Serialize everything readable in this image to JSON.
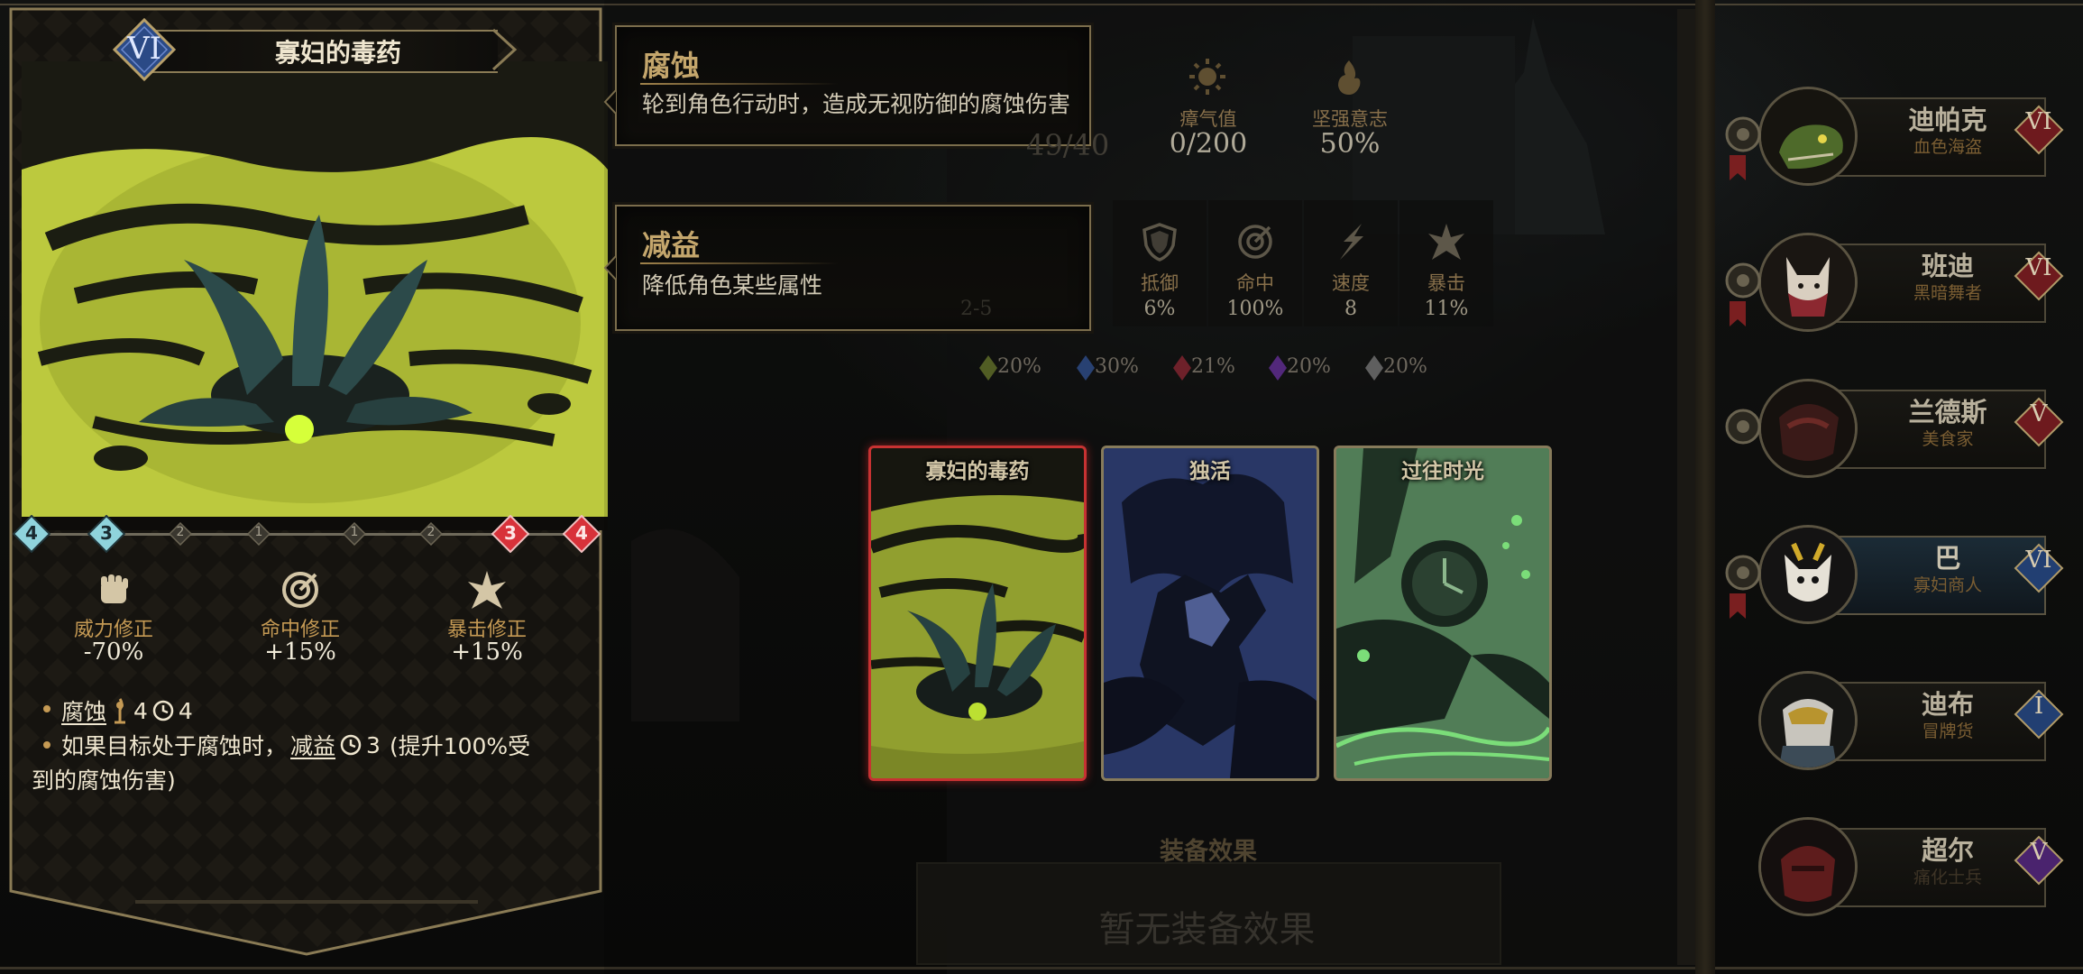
{
  "skill": {
    "rank": "VI",
    "name": "寡妇的毒药",
    "positions": [
      "4",
      "3",
      "2",
      "1",
      "1",
      "2",
      "3",
      "4"
    ],
    "modifiers": [
      {
        "icon": "fist-icon",
        "label": "威力修正",
        "value": "-70%"
      },
      {
        "icon": "target-icon",
        "label": "命中修正",
        "value": "+15%"
      },
      {
        "icon": "crit-burst-icon",
        "label": "暴击修正",
        "value": "+15%"
      }
    ],
    "effects": {
      "line1_keyword": "腐蚀",
      "line1_power": "4",
      "line1_turns": "4",
      "line2_prefix": "如果目标处于腐蚀时，",
      "line2_keyword": "减益",
      "line2_turns": "3",
      "line2_suffix_a": "(提升100%受",
      "line2_suffix_b": "到的腐蚀伤害)"
    }
  },
  "tooltips": [
    {
      "title": "腐蚀",
      "desc": "轮到角色行动时，造成无视防御的腐蚀伤害"
    },
    {
      "title": "减益",
      "desc": "降低角色某些属性"
    }
  ],
  "hero_stats": {
    "hp_partial": "49/40",
    "stress": {
      "label": "瘴气值",
      "value": "0/200"
    },
    "resolve": {
      "label": "坚强意志",
      "value": "50%"
    },
    "combat": [
      {
        "icon": "shield-icon",
        "label": "抵御",
        "value": "6%"
      },
      {
        "icon": "target-icon",
        "label": "命中",
        "value": "100%"
      },
      {
        "icon": "speed-icon",
        "label": "速度",
        "value": "8"
      },
      {
        "icon": "crit-burst-icon",
        "label": "暴击",
        "value": "11%"
      }
    ],
    "damage_partial": "2-5",
    "resistances": [
      {
        "color": "#7d8a3a",
        "value": "20%"
      },
      {
        "color": "#3a5aa0",
        "value": "30%"
      },
      {
        "color": "#a0303a",
        "value": "21%"
      },
      {
        "color": "#7a3ab0",
        "value": "20%"
      },
      {
        "color": "#8a8a8a",
        "value": "20%"
      }
    ]
  },
  "skill_cards": [
    {
      "title": "寡妇的毒药",
      "selected": true
    },
    {
      "title": "独活",
      "selected": false
    },
    {
      "title": "过往时光",
      "selected": false
    }
  ],
  "equipment": {
    "heading": "装备效果",
    "empty_text": "暂无装备效果"
  },
  "party": [
    {
      "name": "迪帕克",
      "title": "血色海盗",
      "rank": "VI",
      "rank_color": "#8c1f1f",
      "active": false
    },
    {
      "name": "班迪",
      "title": "黑暗舞者",
      "rank": "VI",
      "rank_color": "#8c1f1f",
      "active": false
    },
    {
      "name": "兰德斯",
      "title": "美食家",
      "rank": "V",
      "rank_color": "#8c1f1f",
      "active": false
    },
    {
      "name": "巴",
      "title": "寡妇商人",
      "rank": "VI",
      "rank_color": "#2a4e86",
      "active": true
    },
    {
      "name": "迪布",
      "title": "冒牌货",
      "rank": "I",
      "rank_color": "#2a4e86",
      "active": false
    },
    {
      "name": "超尔",
      "title": "痛化士兵",
      "rank": "V",
      "rank_color": "#5a2a86",
      "active": false
    }
  ]
}
